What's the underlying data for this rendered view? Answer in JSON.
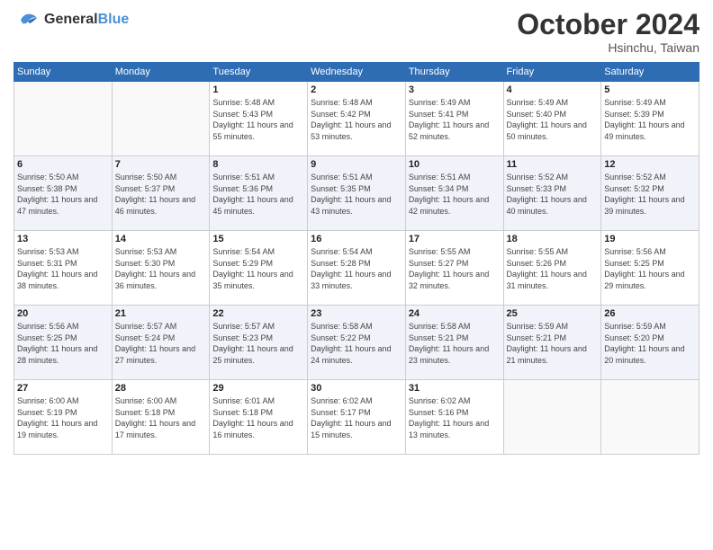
{
  "header": {
    "logo_line1": "General",
    "logo_line2": "Blue",
    "month": "October 2024",
    "location": "Hsinchu, Taiwan"
  },
  "weekdays": [
    "Sunday",
    "Monday",
    "Tuesday",
    "Wednesday",
    "Thursday",
    "Friday",
    "Saturday"
  ],
  "weeks": [
    [
      {
        "day": "",
        "info": ""
      },
      {
        "day": "",
        "info": ""
      },
      {
        "day": "1",
        "info": "Sunrise: 5:48 AM\nSunset: 5:43 PM\nDaylight: 11 hours and 55 minutes."
      },
      {
        "day": "2",
        "info": "Sunrise: 5:48 AM\nSunset: 5:42 PM\nDaylight: 11 hours and 53 minutes."
      },
      {
        "day": "3",
        "info": "Sunrise: 5:49 AM\nSunset: 5:41 PM\nDaylight: 11 hours and 52 minutes."
      },
      {
        "day": "4",
        "info": "Sunrise: 5:49 AM\nSunset: 5:40 PM\nDaylight: 11 hours and 50 minutes."
      },
      {
        "day": "5",
        "info": "Sunrise: 5:49 AM\nSunset: 5:39 PM\nDaylight: 11 hours and 49 minutes."
      }
    ],
    [
      {
        "day": "6",
        "info": "Sunrise: 5:50 AM\nSunset: 5:38 PM\nDaylight: 11 hours and 47 minutes."
      },
      {
        "day": "7",
        "info": "Sunrise: 5:50 AM\nSunset: 5:37 PM\nDaylight: 11 hours and 46 minutes."
      },
      {
        "day": "8",
        "info": "Sunrise: 5:51 AM\nSunset: 5:36 PM\nDaylight: 11 hours and 45 minutes."
      },
      {
        "day": "9",
        "info": "Sunrise: 5:51 AM\nSunset: 5:35 PM\nDaylight: 11 hours and 43 minutes."
      },
      {
        "day": "10",
        "info": "Sunrise: 5:51 AM\nSunset: 5:34 PM\nDaylight: 11 hours and 42 minutes."
      },
      {
        "day": "11",
        "info": "Sunrise: 5:52 AM\nSunset: 5:33 PM\nDaylight: 11 hours and 40 minutes."
      },
      {
        "day": "12",
        "info": "Sunrise: 5:52 AM\nSunset: 5:32 PM\nDaylight: 11 hours and 39 minutes."
      }
    ],
    [
      {
        "day": "13",
        "info": "Sunrise: 5:53 AM\nSunset: 5:31 PM\nDaylight: 11 hours and 38 minutes."
      },
      {
        "day": "14",
        "info": "Sunrise: 5:53 AM\nSunset: 5:30 PM\nDaylight: 11 hours and 36 minutes."
      },
      {
        "day": "15",
        "info": "Sunrise: 5:54 AM\nSunset: 5:29 PM\nDaylight: 11 hours and 35 minutes."
      },
      {
        "day": "16",
        "info": "Sunrise: 5:54 AM\nSunset: 5:28 PM\nDaylight: 11 hours and 33 minutes."
      },
      {
        "day": "17",
        "info": "Sunrise: 5:55 AM\nSunset: 5:27 PM\nDaylight: 11 hours and 32 minutes."
      },
      {
        "day": "18",
        "info": "Sunrise: 5:55 AM\nSunset: 5:26 PM\nDaylight: 11 hours and 31 minutes."
      },
      {
        "day": "19",
        "info": "Sunrise: 5:56 AM\nSunset: 5:25 PM\nDaylight: 11 hours and 29 minutes."
      }
    ],
    [
      {
        "day": "20",
        "info": "Sunrise: 5:56 AM\nSunset: 5:25 PM\nDaylight: 11 hours and 28 minutes."
      },
      {
        "day": "21",
        "info": "Sunrise: 5:57 AM\nSunset: 5:24 PM\nDaylight: 11 hours and 27 minutes."
      },
      {
        "day": "22",
        "info": "Sunrise: 5:57 AM\nSunset: 5:23 PM\nDaylight: 11 hours and 25 minutes."
      },
      {
        "day": "23",
        "info": "Sunrise: 5:58 AM\nSunset: 5:22 PM\nDaylight: 11 hours and 24 minutes."
      },
      {
        "day": "24",
        "info": "Sunrise: 5:58 AM\nSunset: 5:21 PM\nDaylight: 11 hours and 23 minutes."
      },
      {
        "day": "25",
        "info": "Sunrise: 5:59 AM\nSunset: 5:21 PM\nDaylight: 11 hours and 21 minutes."
      },
      {
        "day": "26",
        "info": "Sunrise: 5:59 AM\nSunset: 5:20 PM\nDaylight: 11 hours and 20 minutes."
      }
    ],
    [
      {
        "day": "27",
        "info": "Sunrise: 6:00 AM\nSunset: 5:19 PM\nDaylight: 11 hours and 19 minutes."
      },
      {
        "day": "28",
        "info": "Sunrise: 6:00 AM\nSunset: 5:18 PM\nDaylight: 11 hours and 17 minutes."
      },
      {
        "day": "29",
        "info": "Sunrise: 6:01 AM\nSunset: 5:18 PM\nDaylight: 11 hours and 16 minutes."
      },
      {
        "day": "30",
        "info": "Sunrise: 6:02 AM\nSunset: 5:17 PM\nDaylight: 11 hours and 15 minutes."
      },
      {
        "day": "31",
        "info": "Sunrise: 6:02 AM\nSunset: 5:16 PM\nDaylight: 11 hours and 13 minutes."
      },
      {
        "day": "",
        "info": ""
      },
      {
        "day": "",
        "info": ""
      }
    ]
  ]
}
